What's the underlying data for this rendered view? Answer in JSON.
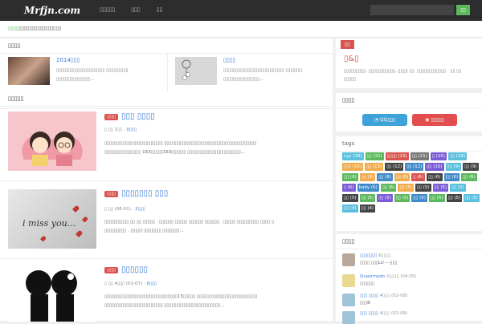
{
  "header": {
    "logo": "Mrfjn.com",
    "nav": [
      "▯▯▯▯▯",
      "▯▯▯",
      "▯▯"
    ],
    "search_placeholder": "",
    "search_button": "▯▯"
  },
  "notice": {
    "highlight": "▯▯▯▯",
    "text": "▯▯▯▯▯▯▯▯▯▯▯▯▯▯▯▯"
  },
  "featured": {
    "title": "▯▯▯▯",
    "items": [
      {
        "title": "2014▯▯▯",
        "desc1": "▯▯▯▯▯▯▯▯▯▯▯▯▯▯▯▯▯▯▯▯ ▯▯▯▯▯▯▯▯▯",
        "desc2": "▯▯▯▯▯▯▯▯▯▯▯▯▯▯..."
      },
      {
        "title": "▯▯▯▯",
        "desc1": "▯▯▯▯▯▯▯▯▯▯▯▯▯▯▯▯▯▯▯▯▯▯▯▯▯ ▯▯▯▯▯▯▯",
        "desc2": "▯▯▯▯▯▯▯▯▯▯▯▯▯▯▯..."
      }
    ]
  },
  "latest_title": "▯▯▯▯▯",
  "posts": [
    {
      "cat": "▯▯▯▯",
      "title": "▯▯▯ ▯▯▯▯",
      "meta_a": "▯ ▯▯ 1▯▯ ·",
      "meta_b": "0▯▯▯",
      "desc1": "▯▯▯▯▯▯▯▯▯▯▯▯▯▯▯▯▯▯▯▯▯▯▯▯ ▯▯▯▯▯▯▯▯▯▯▯▯▯▯▯▯▯▯▯▯▯▯▯▯▯▯▯▯▯▯▯▯▯▯▯▯▯▯",
      "desc2": "▯▯▯▯▯▯▯▯▯▯▯▯▯▯▯ 163▯▯▯▯▯163▯▯▯▯▯▯ ▯▯▯▯▯▯▯▯▯▯▯▯▯▯▯▯▯▯▯▯▯▯..."
    },
    {
      "cat": "▯▯▯▯",
      "title": "▯▯▯▯▯▯▯ ▯▯▯",
      "meta_a": "▯ ▯▯ (06-01) ·",
      "meta_b": "2▯▯▯",
      "desc1": "▯▯▯▯▯▯▯▯▯▯ ▯▯ ▯▯ ▯▯▯▯▯ . ▯▯▯▯▯▯ ▯▯▯▯▯ ▯▯▯▯▯▯ ▯▯▯▯▯▯ . ▯▯▯▯▯ ▯▯▯▯▯▯▯▯▯ ▯▯▯▯ ▯",
      "desc2": "▯▯▯▯▯▯▯▯▯ . ▯▯▯▯▯ ▯▯▯▯▯▯▯ ▯▯▯▯▯▯▯..."
    },
    {
      "cat": "▯▯▯▯",
      "title": "▯▯▯▯▯▯",
      "meta_a": "▯ ▯▯ 4▯▯▯ (02-07) ·",
      "meta_b": "0▯▯▯",
      "desc1": "▯▯▯▯▯▯▯▯▯▯▯▯▯▯▯▯▯▯▯▯▯▯▯▯▯▯▯▯▯▯13▯▯▯▯▯ ▯▯▯▯▯▯▯▯▯▯▯▯▯▯▯▯▯▯▯▯▯▯▯▯▯",
      "desc2": "▯▯▯▯▯▯▯▯▯▯▯▯▯▯▯▯▯▯▯▯▯▯▯▯ ▯▯▯▯▯▯▯▯▯▯▯▯▯▯▯▯▯▯▯▯▯▯▯..."
    }
  ],
  "sidebar": {
    "intro_tag": "▯▯",
    "intro_title": "▯&▯",
    "intro_desc1": "▯▯▯▯▯▯▯▯▯. ▯▯▯▯▯▯▯▯▯▯▯. ▯▯▯▯ ▯▯. ▯▯▯▯▯▯▯▯▯▯▯▯ . ▯▯ ▯▯",
    "intro_desc2": "▯▯▯▯▯",
    "follow_title": "▯▯▯▯",
    "qq_label": "QQ▯▯▯",
    "weibo_label": "▯▯▯▯▯",
    "tags_title": "tags",
    "tags": [
      {
        "t": "cyy (38)",
        "c": "#5bc0de"
      },
      {
        "t": "▯▯ (32)",
        "c": "#5cb85c"
      },
      {
        "t": "▯▯▯▯ (23)",
        "c": "#d9534f"
      },
      {
        "t": "▯▯ (21)",
        "c": "#777777"
      },
      {
        "t": "▯ (20)",
        "c": "#7b5cd6"
      },
      {
        "t": "▯▯ (16)",
        "c": "#5bc0de"
      },
      {
        "t": "▯▯▯ (15)",
        "c": "#f0ad4e"
      },
      {
        "t": "▯▯ (13)",
        "c": "#f0ad4e"
      },
      {
        "t": "▯▯ (12)",
        "c": "#444444"
      },
      {
        "t": "▯▯ (12)",
        "c": "#428bca"
      },
      {
        "t": "▯▯ (10)",
        "c": "#7b5cd6"
      },
      {
        "t": "▯▯ (9)",
        "c": "#5bc0de"
      },
      {
        "t": "▯▯ (9)",
        "c": "#444444"
      },
      {
        "t": "▯▯ (9)",
        "c": "#5cb85c"
      },
      {
        "t": "▯▯ (9)",
        "c": "#f0ad4e"
      },
      {
        "t": "▯▯ (8)",
        "c": "#428bca"
      },
      {
        "t": "▯▯ (8)",
        "c": "#f0ad4e"
      },
      {
        "t": "▯ (6)",
        "c": "#d9534f"
      },
      {
        "t": "▯▯ (6)",
        "c": "#444444"
      },
      {
        "t": "▯▯ (6)",
        "c": "#428bca"
      },
      {
        "t": "▯▯ (6)",
        "c": "#5cb85c"
      },
      {
        "t": "▯ (6)",
        "c": "#7b5cd6"
      },
      {
        "t": "baby (6)",
        "c": "#428bca"
      },
      {
        "t": "▯▯ (6)",
        "c": "#5cb85c"
      },
      {
        "t": "▯▯ (5)",
        "c": "#f0ad4e"
      },
      {
        "t": "▯▯ (5)",
        "c": "#444444"
      },
      {
        "t": "▯▯ (5)",
        "c": "#7b5cd6"
      },
      {
        "t": "▯▯ (5)",
        "c": "#5bc0de"
      },
      {
        "t": "▯▯ (5)",
        "c": "#444444"
      },
      {
        "t": "▯▯ (5)",
        "c": "#5cb85c"
      },
      {
        "t": "▯▯ (5)",
        "c": "#7b5cd6"
      },
      {
        "t": "▯▯ (5)",
        "c": "#5cb85c"
      },
      {
        "t": "▯▯ (5)",
        "c": "#428bca"
      },
      {
        "t": "▯▯ (5)",
        "c": "#5cb85c"
      },
      {
        "t": "▯▯ (5)",
        "c": "#444444"
      },
      {
        "t": "▯▯ (5)",
        "c": "#5bc0de"
      },
      {
        "t": "▯▯ (4)",
        "c": "#5bc0de"
      },
      {
        "t": "▯▯ (4)",
        "c": "#444444"
      }
    ],
    "comments_title": "▯▯▯▯",
    "comments": [
      {
        "name": "▯▯▯▯▯▯▯ ",
        "date": "6▯▯▯▯",
        "text": "▯▯▯▯ ▯▯▯LU ---▯▯▯"
      },
      {
        "name": "Quasimodo ",
        "date": "2▯▯▯▯ (04-05)",
        "text": "▯▯▯▯▯▯"
      },
      {
        "name": "▯▯▯ ▯▯▯▯ ",
        "date": "4▯▯▯ (02-08)",
        "text": "▯▯▯B"
      },
      {
        "name": "▯▯▯ ▯▯▯▯ ",
        "date": "4▯▯▯ (02-08)",
        "text": ""
      }
    ]
  },
  "colors": {
    "topbar": "#2d2d2d",
    "accent": "#3a7bd5",
    "red": "#d9534f",
    "green": "#5cb85c"
  }
}
